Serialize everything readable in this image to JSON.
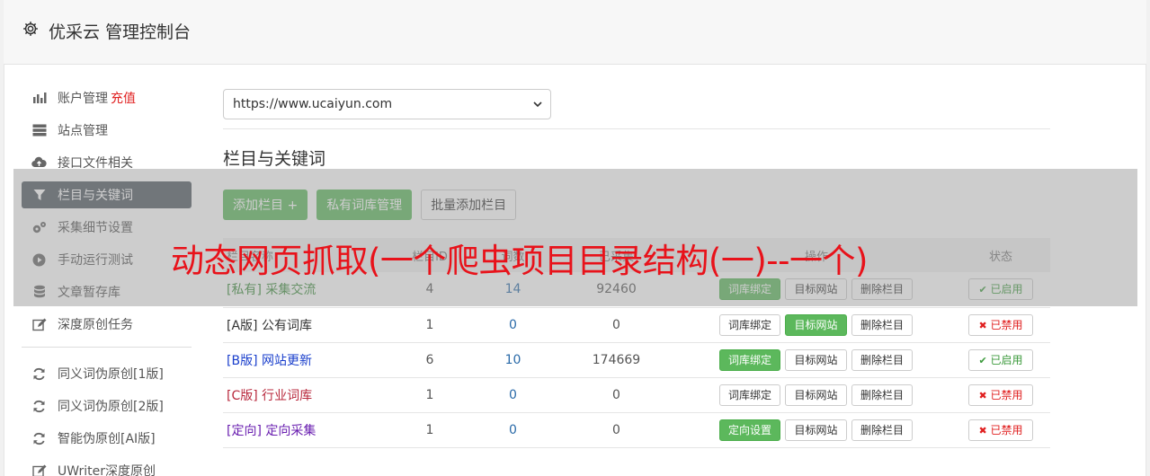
{
  "header": {
    "title": "优采云 管理控制台",
    "icon": "gear-icon"
  },
  "sidebar": {
    "group1": [
      {
        "icon": "bar-chart-icon",
        "label": "账户管理",
        "extra": "充值"
      },
      {
        "icon": "server-icon",
        "label": "站点管理"
      },
      {
        "icon": "cloud-upload-icon",
        "label": "接口文件相关"
      },
      {
        "icon": "filter-icon",
        "label": "栏目与关键词",
        "active": true
      },
      {
        "icon": "cogs-icon",
        "label": "采集细节设置"
      },
      {
        "icon": "play-circle-icon",
        "label": "手动运行测试"
      },
      {
        "icon": "database-icon",
        "label": "文章暂存库"
      },
      {
        "icon": "edit-icon",
        "label": "深度原创任务"
      }
    ],
    "group2": [
      {
        "icon": "refresh-icon",
        "label": "同义词伪原创[1版]"
      },
      {
        "icon": "refresh-icon",
        "label": "同义词伪原创[2版]"
      },
      {
        "icon": "refresh-icon",
        "label": "智能伪原创[AI版]"
      },
      {
        "icon": "edit-icon",
        "label": "UWriter深度原创"
      }
    ]
  },
  "site_select": {
    "value": "https://www.ucaiyun.com"
  },
  "section_title": "栏目与关键词",
  "buttons": {
    "add_column": "添加栏目 +",
    "private_lib": "私有词库管理",
    "batch_add": "批量添加栏目"
  },
  "table": {
    "headers": [
      "栏目名称",
      "栏目ID",
      "词数",
      "已采集",
      "操作",
      "状态"
    ],
    "rows": [
      {
        "tag": "[私有]",
        "name": "采集交流",
        "id": "4",
        "words": "14",
        "collected": "92460",
        "b1": "词库绑定",
        "b1_green": true,
        "b2": "目标网站",
        "b2_green": false,
        "b3": "删除栏目",
        "status": "已启用",
        "on": true,
        "color": "#3c8c3c"
      },
      {
        "tag": "[A版]",
        "name": "公有词库",
        "id": "1",
        "words": "0",
        "collected": "0",
        "b1": "词库绑定",
        "b1_green": false,
        "b2": "目标网站",
        "b2_green": true,
        "b3": "删除栏目",
        "status": "已禁用",
        "on": false,
        "color": "#333333"
      },
      {
        "tag": "[B版]",
        "name": "网站更新",
        "id": "6",
        "words": "10",
        "collected": "174669",
        "b1": "词库绑定",
        "b1_green": true,
        "b2": "目标网站",
        "b2_green": false,
        "b3": "删除栏目",
        "status": "已启用",
        "on": true,
        "color": "#1a3fcc"
      },
      {
        "tag": "[C版]",
        "name": "行业词库",
        "id": "1",
        "words": "0",
        "collected": "0",
        "b1": "词库绑定",
        "b1_green": false,
        "b2": "目标网站",
        "b2_green": false,
        "b3": "删除栏目",
        "status": "已禁用",
        "on": false,
        "color": "#b8283c"
      },
      {
        "tag": "[定向]",
        "name": "定向采集",
        "id": "1",
        "words": "0",
        "collected": "0",
        "b1": "定向设置",
        "b1_green": true,
        "b2": "目标网站",
        "b2_green": false,
        "b3": "删除栏目",
        "status": "已禁用",
        "on": false,
        "color": "#6a1fb0"
      }
    ]
  },
  "overlay_text": "动态网页抓取(一个爬虫项目目录结构(一)--一个)"
}
